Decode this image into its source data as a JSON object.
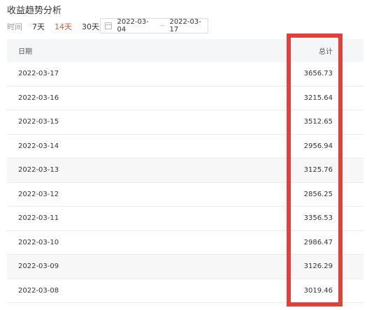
{
  "page": {
    "title": "收益趋势分析"
  },
  "filters": {
    "label": "时间",
    "ranges": [
      "7天",
      "14天",
      "30天"
    ],
    "active_range": "14天"
  },
  "date_picker": {
    "start": "2022-03-04",
    "separator": "~",
    "end": "2022-03-17",
    "icon": "calendar-icon"
  },
  "table": {
    "columns": [
      "日期",
      "总计"
    ],
    "rows": [
      {
        "date": "2022-03-17",
        "total": "3656.73"
      },
      {
        "date": "2022-03-16",
        "total": "3215.64"
      },
      {
        "date": "2022-03-15",
        "total": "3512.65"
      },
      {
        "date": "2022-03-14",
        "total": "2956.94"
      },
      {
        "date": "2022-03-13",
        "total": "3125.76"
      },
      {
        "date": "2022-03-12",
        "total": "2856.25"
      },
      {
        "date": "2022-03-11",
        "total": "3356.53"
      },
      {
        "date": "2022-03-10",
        "total": "2986.47"
      },
      {
        "date": "2022-03-09",
        "total": "3126.29"
      },
      {
        "date": "2022-03-08",
        "total": "3019.46"
      }
    ]
  },
  "colors": {
    "active": "#e8542f",
    "highlight": "#e0423b",
    "header_bg": "#f5f6f8"
  }
}
